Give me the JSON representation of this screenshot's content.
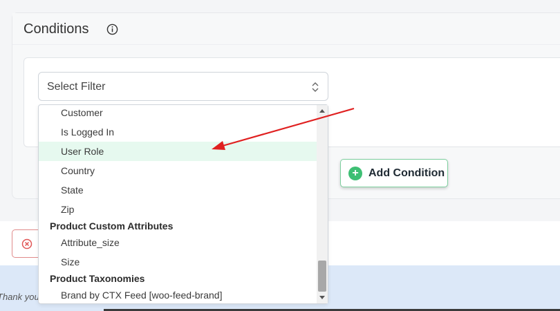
{
  "conditions": {
    "title": "Conditions",
    "info_icon": "info-circle-icon"
  },
  "select_filter": {
    "value": "Select Filter",
    "caret_icon": "updown-caret-icon"
  },
  "dropdown": {
    "items": [
      {
        "label": "Customer"
      },
      {
        "label": "Is Logged In"
      },
      {
        "label": "User Role",
        "highlighted": true
      },
      {
        "label": "Country"
      },
      {
        "label": "State"
      },
      {
        "label": "Zip"
      }
    ],
    "group_custom_attributes": "Product Custom Attributes",
    "custom_items": [
      {
        "label": "Attribute_size"
      },
      {
        "label": "Size"
      }
    ],
    "group_taxonomies": "Product Taxonomies",
    "taxonomy_items": [
      {
        "label": "Brand by CTX Feed [woo-feed-brand]"
      }
    ]
  },
  "add_condition": {
    "label": "Add Condition",
    "icon": "plus-circle-icon",
    "accent": "#3ebf74"
  },
  "cancel": {
    "icon": "close-circle-icon",
    "accent": "#e05555"
  },
  "footer": {
    "text": "Thank you"
  },
  "annotation": {
    "arrow_color": "#e02020"
  }
}
